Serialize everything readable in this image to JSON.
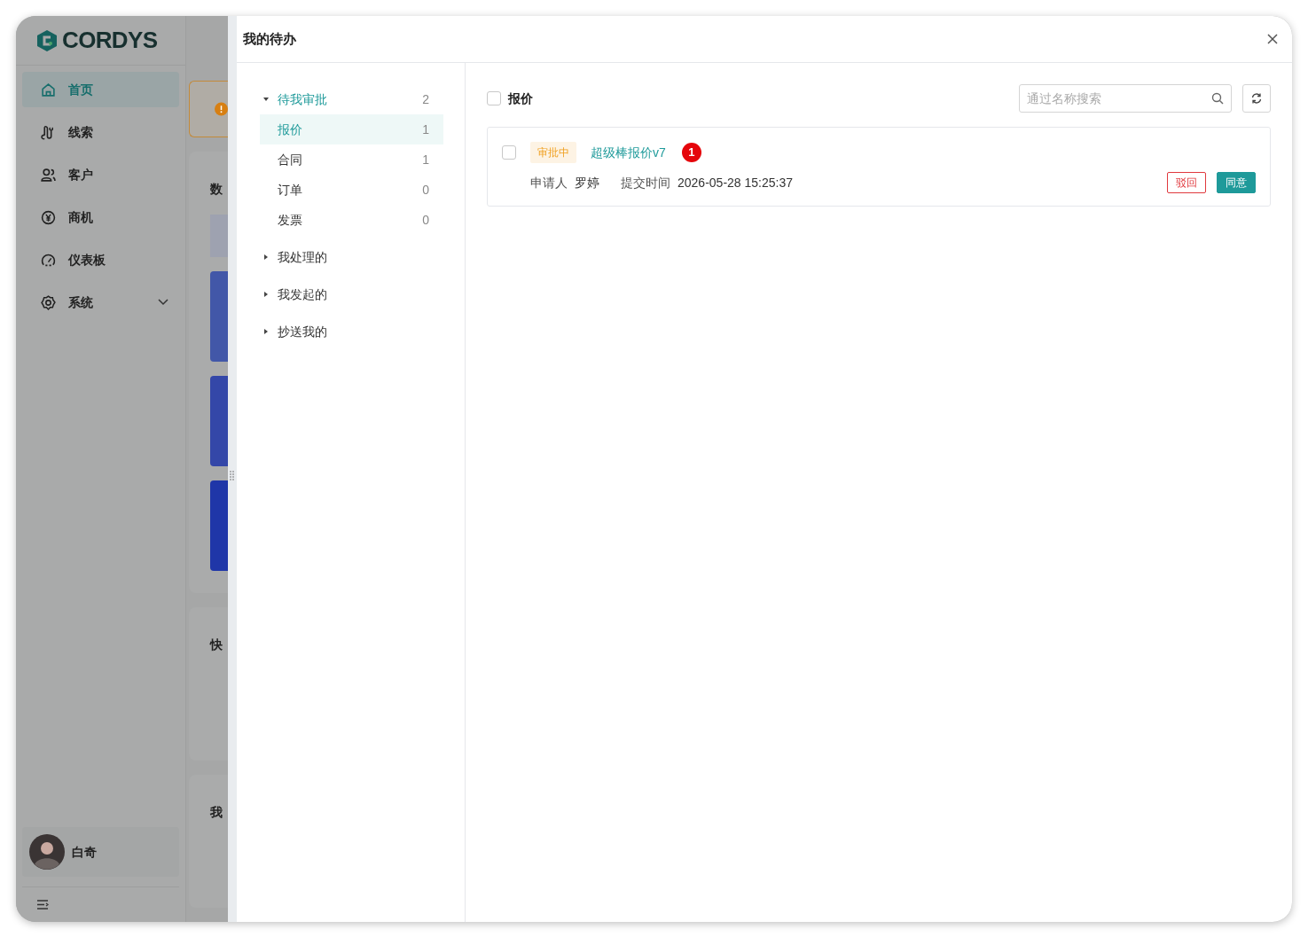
{
  "app": {
    "logo": "CORDYS",
    "nav": [
      {
        "label": "首页",
        "selected": true,
        "expandable": false
      },
      {
        "label": "线索",
        "selected": false,
        "expandable": false
      },
      {
        "label": "客户",
        "selected": false,
        "expandable": false
      },
      {
        "label": "商机",
        "selected": false,
        "expandable": false
      },
      {
        "label": "仪表板",
        "selected": false,
        "expandable": false
      },
      {
        "label": "系统",
        "selected": false,
        "expandable": true
      }
    ],
    "user": {
      "name": "白奇"
    },
    "cards": [
      {
        "heading": "数"
      },
      {
        "heading": "快"
      },
      {
        "heading": "我"
      }
    ]
  },
  "drawer": {
    "title": "我的待办",
    "tree": [
      {
        "label": "待我审批",
        "count": "2",
        "expanded": true,
        "children": [
          {
            "label": "报价",
            "count": "1",
            "selected": true
          },
          {
            "label": "合同",
            "count": "1",
            "selected": false
          },
          {
            "label": "订单",
            "count": "0",
            "selected": false
          },
          {
            "label": "发票",
            "count": "0",
            "selected": false
          }
        ]
      },
      {
        "label": "我处理的",
        "expanded": false
      },
      {
        "label": "我发起的",
        "expanded": false
      },
      {
        "label": "抄送我的",
        "expanded": false
      }
    ],
    "list_header": {
      "label": "报价",
      "checked": false
    },
    "search": {
      "placeholder": "通过名称搜索"
    },
    "items": [
      {
        "checked": false,
        "status": "审批中",
        "title": "超级棒报价v7",
        "badge": "1",
        "applicant_label": "申请人",
        "applicant": "罗婷",
        "time_label": "提交时间",
        "time": "2026-05-28 15:25:37",
        "actions": [
          {
            "label": "驳回",
            "kind": "reject"
          },
          {
            "label": "同意",
            "kind": "approve"
          }
        ]
      }
    ]
  }
}
